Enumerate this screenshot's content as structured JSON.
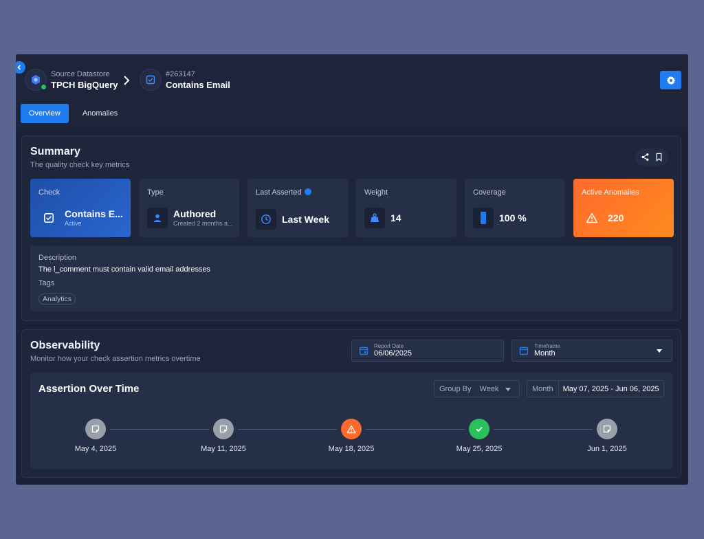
{
  "breadcrumb": {
    "source_label": "Source Datastore",
    "source_name": "TPCH BigQuery",
    "check_id": "#263147",
    "check_name": "Contains Email"
  },
  "tabs": [
    {
      "label": "Overview",
      "active": true
    },
    {
      "label": "Anomalies",
      "active": false
    }
  ],
  "summary": {
    "title": "Summary",
    "subtitle": "The quality check key metrics",
    "cards": {
      "check": {
        "label": "Check",
        "value": "Contains E...",
        "sub": "Active"
      },
      "type": {
        "label": "Type",
        "value": "Authored",
        "sub": "Created 2 months a..."
      },
      "last_asserted": {
        "label": "Last Asserted",
        "value": "Last Week"
      },
      "weight": {
        "label": "Weight",
        "value": "14"
      },
      "coverage": {
        "label": "Coverage",
        "value": "100 %"
      },
      "anomalies": {
        "label": "Active Anomalies",
        "value": "220"
      }
    },
    "description_label": "Description",
    "description": "The l_comment must contain valid email addresses",
    "tags_label": "Tags",
    "tags": [
      "Analytics"
    ]
  },
  "observability": {
    "title": "Observability",
    "subtitle": "Monitor how your check assertion metrics overtime",
    "report_date_label": "Report Date",
    "report_date": "06/06/2025",
    "timeframe_label": "Timeframe",
    "timeframe": "Month",
    "assertion": {
      "title": "Assertion Over Time",
      "group_by_label": "Group By",
      "group_by": "Week",
      "range_label": "Month",
      "range": "May 07, 2025 - Jun 06, 2025",
      "points": [
        {
          "date": "May 4, 2025",
          "status": "no-data"
        },
        {
          "date": "May 11, 2025",
          "status": "no-data"
        },
        {
          "date": "May 18, 2025",
          "status": "anomaly"
        },
        {
          "date": "May 25, 2025",
          "status": "passed"
        },
        {
          "date": "Jun 1, 2025",
          "status": "no-data"
        }
      ]
    }
  },
  "colors": {
    "accent": "#1f7cf0",
    "anomaly": "#ff6a2c",
    "passed": "#2bc15a",
    "no_data": "#9aa0aa"
  }
}
